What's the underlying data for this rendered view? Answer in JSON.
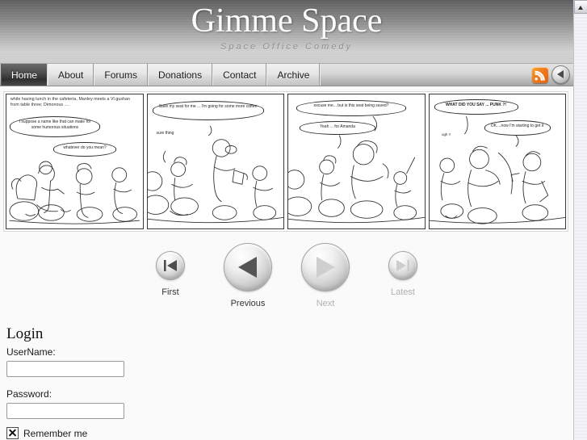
{
  "site": {
    "title": "Gimme Space",
    "subtitle": "Space Office Comedy"
  },
  "nav": {
    "items": [
      {
        "label": "Home",
        "active": true
      },
      {
        "label": "About",
        "active": false
      },
      {
        "label": "Forums",
        "active": false
      },
      {
        "label": "Donations",
        "active": false
      },
      {
        "label": "Contact",
        "active": false
      },
      {
        "label": "Archive",
        "active": false
      }
    ],
    "rss_icon": "rss-icon",
    "back_icon": "back-arrow-icon"
  },
  "comic": {
    "panels": [
      {
        "caption": "while having lunch in the cafeteria, Manley meets a Vl.gushan from table three; Dimonous ....",
        "bubbles": [
          "I suppose a name like that can make for some humorous situations",
          "whatever do you mean?"
        ]
      },
      {
        "caption": "",
        "bubbles": [
          "Save my seat for me ... I'm going for some more coffee",
          "sure thing"
        ]
      },
      {
        "caption": "",
        "bubbles": [
          "excuse me... but is this seat being saved?",
          "Yeah ... for Amanda"
        ]
      },
      {
        "caption": "",
        "bubbles": [
          "WHAT DID YOU SAY ... PUNK ?!",
          "OK....now I'm starting to get it",
          "ugh !!"
        ]
      }
    ]
  },
  "comic_nav": {
    "buttons": [
      {
        "label": "First",
        "icon": "skip-back-icon",
        "size": "sm",
        "disabled": false
      },
      {
        "label": "Previous",
        "icon": "play-back-icon",
        "size": "lg",
        "disabled": false
      },
      {
        "label": "Next",
        "icon": "play-forward-icon",
        "size": "lg",
        "disabled": true
      },
      {
        "label": "Latest",
        "icon": "skip-forward-icon",
        "size": "sm",
        "disabled": true
      }
    ]
  },
  "login": {
    "title": "Login",
    "username_label": "UserName:",
    "username_value": "",
    "username_placeholder": "",
    "password_label": "Password:",
    "password_value": "",
    "password_placeholder": "",
    "remember_label": "Remember me",
    "remember_checked": true
  },
  "scrollbar": {
    "up_icon": "scroll-up-arrow-icon"
  },
  "colors": {
    "accent_rss": "#f07c1d",
    "nav_active_bg": "#2f2f2f",
    "page_bg": "#fafafa"
  }
}
